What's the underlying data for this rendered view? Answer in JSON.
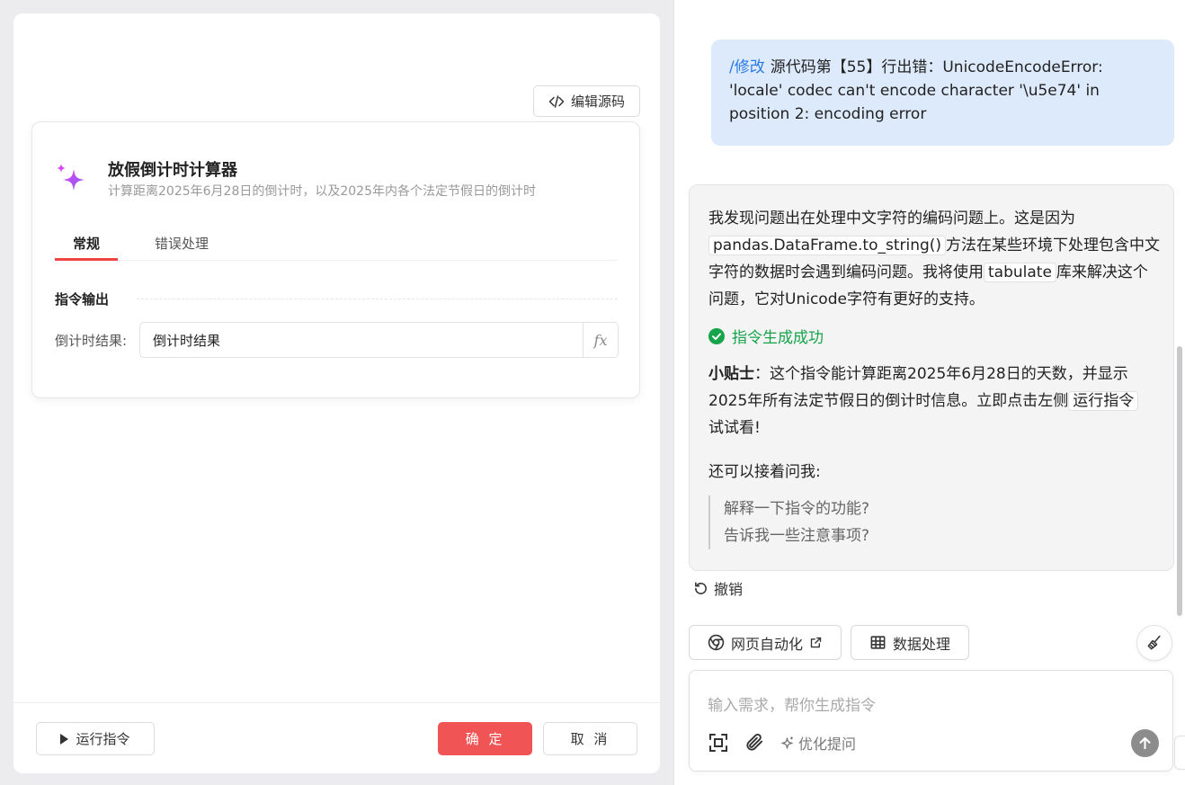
{
  "left": {
    "edit_source_label": "编辑源码",
    "card": {
      "title": "放假倒计时计算器",
      "subtitle": "计算距离2025年6月28日的倒计时，以及2025年内各个法定节假日的倒计时",
      "tabs": [
        {
          "label": "常规",
          "active": true
        },
        {
          "label": "错误处理",
          "active": false
        }
      ],
      "section_title": "指令输出",
      "field_label": "倒计时结果:",
      "field_value": "倒计时结果",
      "fx_label": "fx"
    },
    "footer": {
      "run_label": "运行指令",
      "ok_label": "确 定",
      "cancel_label": "取 消"
    }
  },
  "right": {
    "user_message": {
      "command": "/修改",
      "text": "源代码第【55】行出错：UnicodeEncodeError: 'locale' codec can't encode character '\\u5e74' in position 2: encoding error"
    },
    "ai_message": {
      "p1_a": "我发现问题出在处理中文字符的编码问题上。这是因为",
      "p1_code1": "pandas.DataFrame.to_string()",
      "p1_b": "方法在某些环境下处理包含中文字符的数据时会遇到编码问题。我将使用",
      "p1_code2": "tabulate",
      "p1_c": "库来解决这个问题，它对Unicode字符有更好的支持。",
      "success_text": "指令生成成功",
      "tip_label": "小贴士",
      "tip_a": "：这个指令能计算距离2025年6月28日的天数，并显示2025年所有法定节假日的倒计时信息。立即点击左侧",
      "tip_code": "运行指令",
      "tip_b": "试试看!",
      "ask_more": "还可以接着问我:",
      "suggestions": [
        "解释一下指令的功能?",
        "告诉我一些注意事项?"
      ]
    },
    "undo_label": "撤销",
    "chips": {
      "web": "网页自动化",
      "data": "数据处理"
    },
    "input": {
      "placeholder": "输入需求，帮你生成指令",
      "optimize_label": "优化提问"
    },
    "colors": {
      "accent_red": "#f05454",
      "user_bubble": "#ddeafc",
      "link_blue": "#2b7be4",
      "success_green": "#16a34a"
    }
  }
}
